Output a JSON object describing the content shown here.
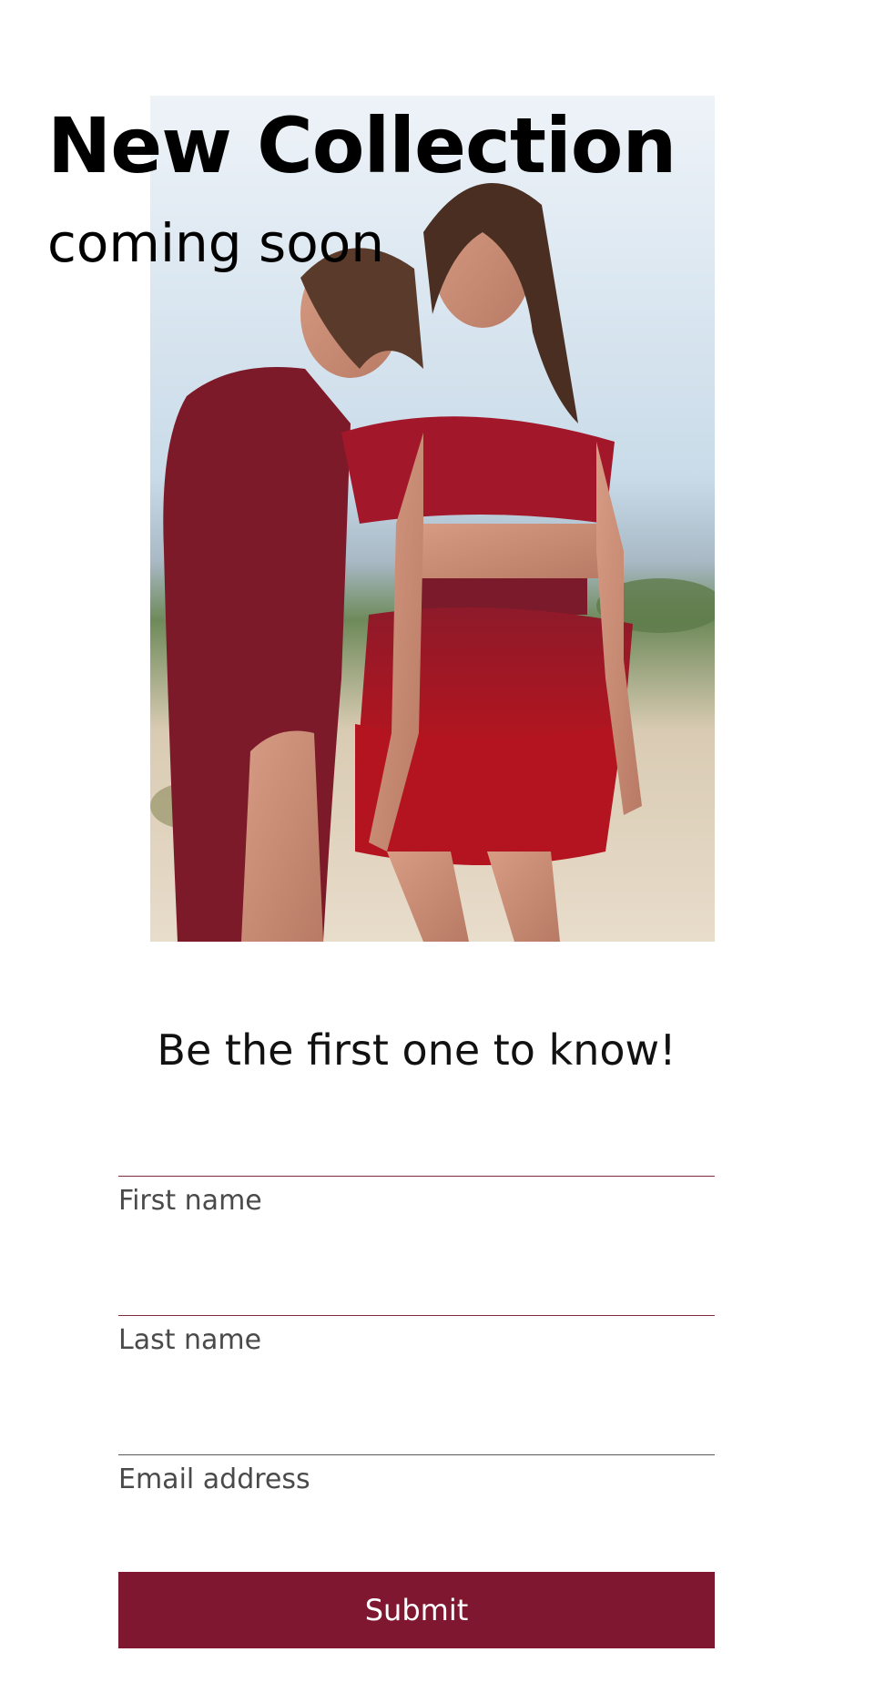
{
  "hero": {
    "headline": "New Collection",
    "subline": "coming soon"
  },
  "signup": {
    "tagline": "Be the first one to know!",
    "first_name_label": "First name",
    "last_name_label": "Last name",
    "email_label": "Email address",
    "submit_label": "Submit"
  },
  "colors": {
    "accent": "#801730",
    "field_underline": "#7e2c3a"
  }
}
